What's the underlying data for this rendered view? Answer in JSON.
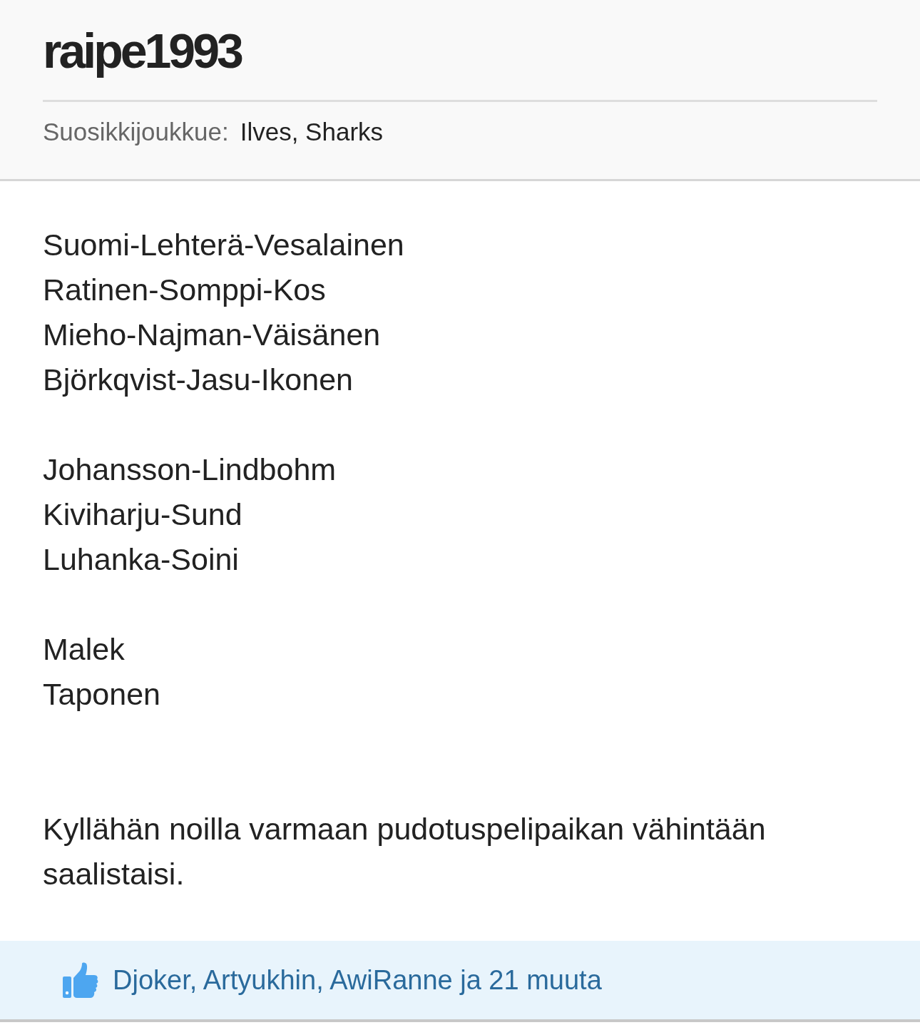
{
  "profile": {
    "username": "raipe1993",
    "favorite_team": {
      "label": "Suosikkijoukkue:",
      "value": "Ilves, Sharks"
    }
  },
  "post": {
    "blocks": [
      {
        "kind": "lineup",
        "lines": [
          "Suomi-Lehterä-Vesalainen",
          "Ratinen-Somppi-Kos",
          "Mieho-Najman-Väisänen",
          "Björkqvist-Jasu-Ikonen"
        ]
      },
      {
        "kind": "lineup",
        "lines": [
          "Johansson-Lindbohm",
          "Kiviharju-Sund",
          "Luhanka-Soini"
        ]
      },
      {
        "kind": "lineup",
        "lines": [
          "Malek",
          "Taponen"
        ]
      },
      {
        "kind": "text",
        "text": "Kyllähän noilla varmaan pudotuspelipaikan vähintään saalistaisi."
      }
    ]
  },
  "likes": {
    "text": "Djoker, Artyukhin, AwiRanne ja 21 muuta"
  }
}
